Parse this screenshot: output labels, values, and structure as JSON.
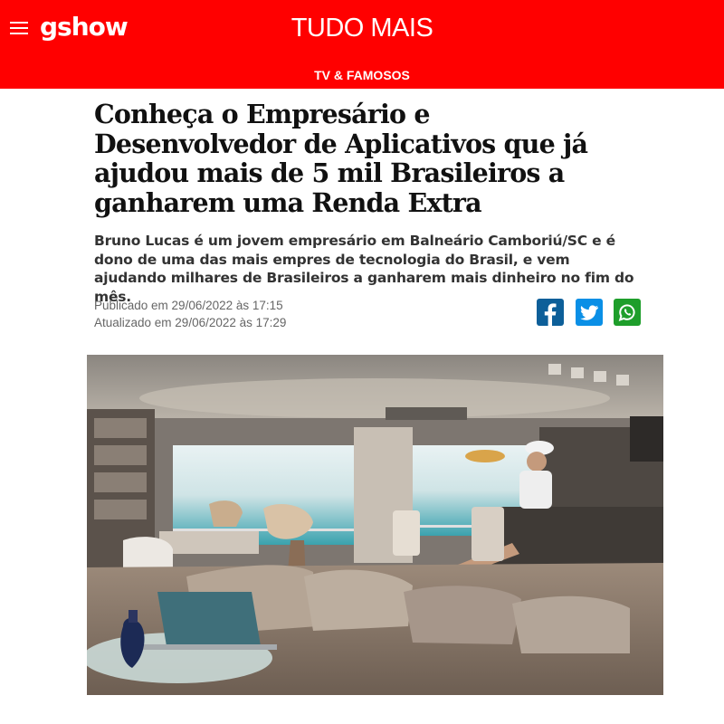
{
  "header": {
    "menu_icon": "hamburger-menu-icon",
    "logo": "gshow",
    "section": "TUDO MAIS",
    "subsection": "TV & FAMOSOS",
    "brand_color": "#ff0000"
  },
  "article": {
    "headline": "Conheça o Empresário e Desenvolvedor de Aplicativos que já ajudou mais de 5 mil Brasileiros a ganharem uma Renda Extra",
    "lede": "Bruno Lucas é um jovem empresário em Balneário Camboriú/SC e é dono de uma das mais empres de tecnologia do Brasil, e vem ajudando milhares de Brasileiros a ganharem mais dinheiro no fim do mês.",
    "published": "Publicado em 29/06/2022 às 17:15",
    "updated": "Atualizado em 29/06/2022 às 17:29",
    "share": [
      {
        "icon": "facebook-icon",
        "color": "#0d5f99"
      },
      {
        "icon": "twitter-icon",
        "color": "#0a8fe6"
      },
      {
        "icon": "whatsapp-icon",
        "color": "#1e9e2b"
      }
    ],
    "photo": {
      "content": "Man in white cap sitting in a penthouse living room with ocean view, laptop and bottle on a round table in front of a sofa",
      "laptop_logo": ""
    }
  }
}
